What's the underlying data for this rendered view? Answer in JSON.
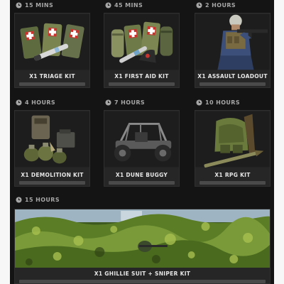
{
  "kits": [
    {
      "time": "15 MINS",
      "name": "X1 TRIAGE KIT"
    },
    {
      "time": "45 MINS",
      "name": "X1 FIRST AID KIT"
    },
    {
      "time": "2 HOURS",
      "name": "X1 ASSAULT LOADOUT"
    },
    {
      "time": "4 HOURS",
      "name": "X1 DEMOLITION KIT"
    },
    {
      "time": "7 HOURS",
      "name": "X1 DUNE BUGGY"
    },
    {
      "time": "10 HOURS",
      "name": "X1 RPG KIT"
    },
    {
      "time": "15 HOURS",
      "name": "X1 GHILLIE SUIT + SNIPER KIT"
    }
  ],
  "progress": [
    0,
    0,
    0,
    0,
    0,
    0,
    0
  ],
  "colors": {
    "panel_bg": "#141414",
    "card_bg": "#262626",
    "label_gray": "#a6a6a6",
    "medkit_red": "#c8332e",
    "camo_green": "#6d7a45",
    "foliage_green": "#7a9a3a"
  },
  "icons": {
    "timer": "clock-icon"
  }
}
